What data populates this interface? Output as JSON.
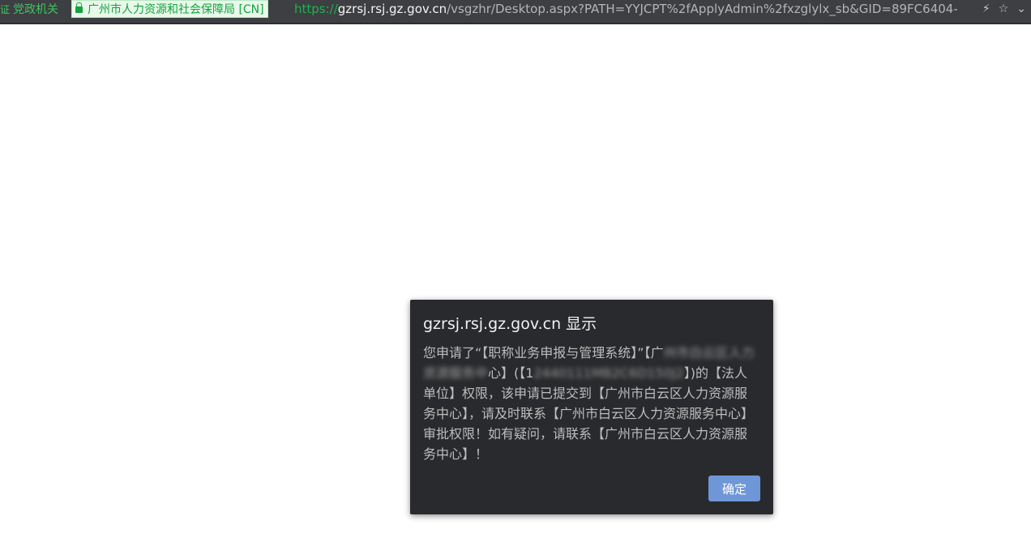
{
  "addressbar": {
    "gov_badge": "党政机关",
    "cert_org": "广州市人力资源和社会保障局 [CN]",
    "url_scheme": "https://",
    "url_host": "gzrsj.rsj.gz.gov.cn",
    "url_path": "/vsgzhr/Desktop.aspx?PATH=YYJCPT%2fApplyAdmin%2fxzglylx_sb&GID=89FC6404-",
    "icons": [
      "lightning-icon",
      "star-icon",
      "chevron-down-icon"
    ]
  },
  "dialog": {
    "title": "gzrsj.rsj.gz.gov.cn 显示",
    "msg_part1": "您申请了“【职称业务申报与管理系统】”【广",
    "msg_redacted1": "州市白云区人力资源服务中",
    "msg_part2": "心】(【1",
    "msg_redacted2": "2440111MB2C6D150J2",
    "msg_part3": "】)的【法人单位】权限，该申请已提交到【广州市白云区人力资源服务中心】，请及时联系【广州市白云区人力资源服务中心】审批权限！如有疑问，请联系【广州市白云区人力资源服务中心】！",
    "ok_label": "确定"
  },
  "colors": {
    "topbar_bg": "#3d3f42",
    "dialog_bg": "#292a2d",
    "button_bg": "#6f97d8",
    "secure_green": "#13a43d"
  }
}
